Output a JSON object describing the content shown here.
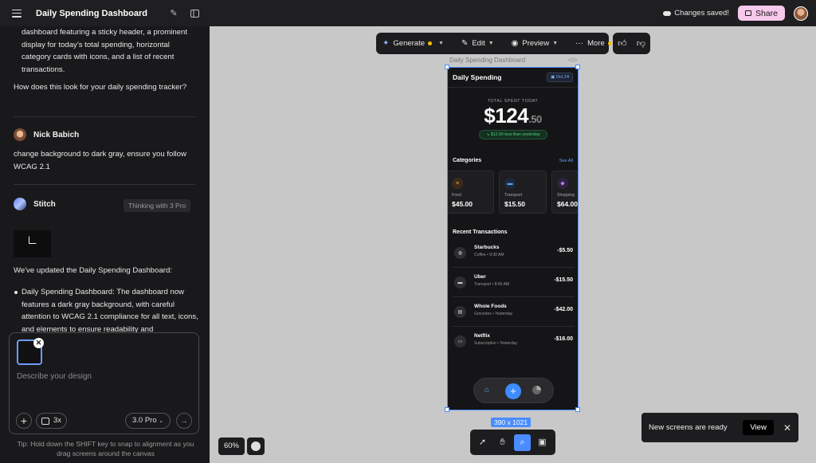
{
  "header": {
    "title": "Daily Spending Dashboard",
    "saved_status": "Changes saved!",
    "share_label": "Share"
  },
  "chat": {
    "ai_text_partial": "dashboard featuring a sticky header, a prominent display for today's total spending, horizontal category cards with icons, and a list of recent transactions.",
    "ai_question": "How does this look for your daily spending tracker?",
    "user_name": "Nick Babich",
    "user_message": "change background to dark gray, ensure you follow WCAG 2.1",
    "ai_name": "Stitch",
    "thinking_badge": "Thinking with 3 Pro",
    "ai_update": "We've updated the Daily Spending Dashboard:",
    "bullet": "Daily Spending Dashboard: The dashboard now features a dark gray background, with careful attention to WCAG 2.1 compliance for all text, icons, and elements to ensure readability and"
  },
  "composer": {
    "placeholder": "Describe your design",
    "variants_label": "3x",
    "model_label": "3.0 Pro",
    "tip": "Tip: Hold down the SHIFT key to snap to alignment as you drag screens around the canvas"
  },
  "toolbar": {
    "generate": "Generate",
    "edit": "Edit",
    "preview": "Preview",
    "more": "More"
  },
  "frame": {
    "label": "Daily Spending Dashboard",
    "size": "390 x 1021"
  },
  "phone": {
    "title": "Daily Spending",
    "date": "Oct 24",
    "total_label": "TOTAL SPENT TODAY",
    "total_dollars": "$124",
    "total_cents": ".50",
    "delta": "↘ $12.00 less than yesterday",
    "categories_heading": "Categories",
    "see_all": "See All",
    "categories": [
      {
        "label": "Food",
        "value": "$45.00",
        "icon": "burger-icon",
        "color": "#3a2a1c"
      },
      {
        "label": "Transport",
        "value": "$15.50",
        "icon": "car-icon",
        "color": "#1d2a3e"
      },
      {
        "label": "Shopping",
        "value": "$64.00",
        "icon": "bag-icon",
        "color": "#2e223e"
      }
    ],
    "transactions_heading": "Recent Transactions",
    "transactions": [
      {
        "name": "Starbucks",
        "meta": "Coffee • 9:30 AM",
        "amount": "-$5.50",
        "icon": "coffee-icon"
      },
      {
        "name": "Uber",
        "meta": "Transport • 8:45 AM",
        "amount": "-$15.50",
        "icon": "car-icon"
      },
      {
        "name": "Whole Foods",
        "meta": "Groceries • Yesterday",
        "amount": "-$42.00",
        "icon": "cart-icon"
      },
      {
        "name": "Netflix",
        "meta": "Subscription • Yesterday",
        "amount": "-$16.00",
        "icon": "tv-icon"
      }
    ]
  },
  "zoom_level": "60%",
  "toast": {
    "message": "New screens are ready",
    "action": "View"
  },
  "colors": {
    "accent": "#4a8cff",
    "share_bg": "#f6c8ec",
    "positive": "#4ccf7d"
  }
}
